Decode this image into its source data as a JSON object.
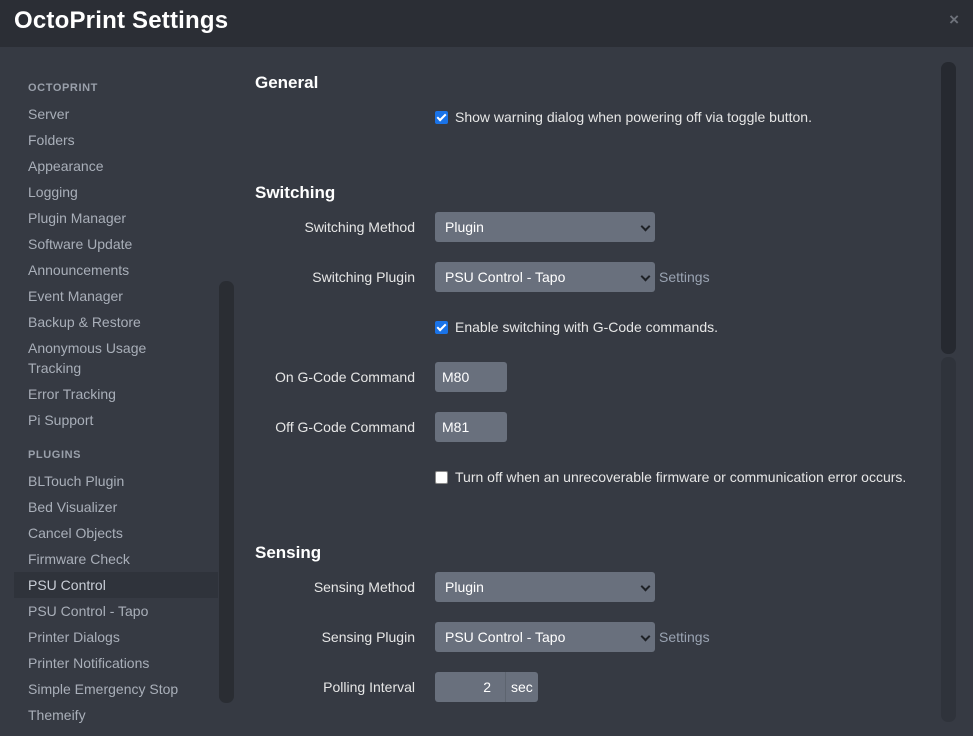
{
  "header": {
    "title": "OctoPrint Settings",
    "close_icon": "×"
  },
  "sidebar": {
    "sections": [
      {
        "heading": "OCTOPRINT",
        "items": [
          "Server",
          "Folders",
          "Appearance",
          "Logging",
          "Plugin Manager",
          "Software Update",
          "Announcements",
          "Event Manager",
          "Backup & Restore",
          "Anonymous Usage",
          "Tracking",
          "Error Tracking",
          "Pi Support"
        ]
      },
      {
        "heading": "PLUGINS",
        "items": [
          "BLTouch Plugin",
          "Bed Visualizer",
          "Cancel Objects",
          "Firmware Check",
          "PSU Control",
          "PSU Control - Tapo",
          "Printer Dialogs",
          "Printer Notifications",
          "Simple Emergency Stop",
          "Themeify"
        ]
      }
    ],
    "active_item": "PSU Control"
  },
  "general": {
    "heading": "General",
    "warning_checkbox_label": "Show warning dialog when powering off via toggle button.",
    "warning_checked": true
  },
  "switching": {
    "heading": "Switching",
    "method_label": "Switching Method",
    "method_value": "Plugin",
    "plugin_label": "Switching Plugin",
    "plugin_value": "PSU Control - Tapo",
    "settings_link": "Settings",
    "gcode_checkbox_label": "Enable switching with G-Code commands.",
    "gcode_checked": true,
    "on_label": "On G-Code Command",
    "on_value": "M80",
    "off_label": "Off G-Code Command",
    "off_value": "M81",
    "error_checkbox_label": "Turn off when an unrecoverable firmware or communication error occurs.",
    "error_checked": false
  },
  "sensing": {
    "heading": "Sensing",
    "method_label": "Sensing Method",
    "method_value": "Plugin",
    "plugin_label": "Sensing Plugin",
    "plugin_value": "PSU Control - Tapo",
    "settings_link": "Settings",
    "polling_label": "Polling Interval",
    "polling_value": "2",
    "polling_unit": "sec"
  },
  "colors": {
    "background": "#363a43",
    "header": "#2b2e35",
    "control": "#69707d",
    "checkbox_accent": "#1a73e8"
  }
}
